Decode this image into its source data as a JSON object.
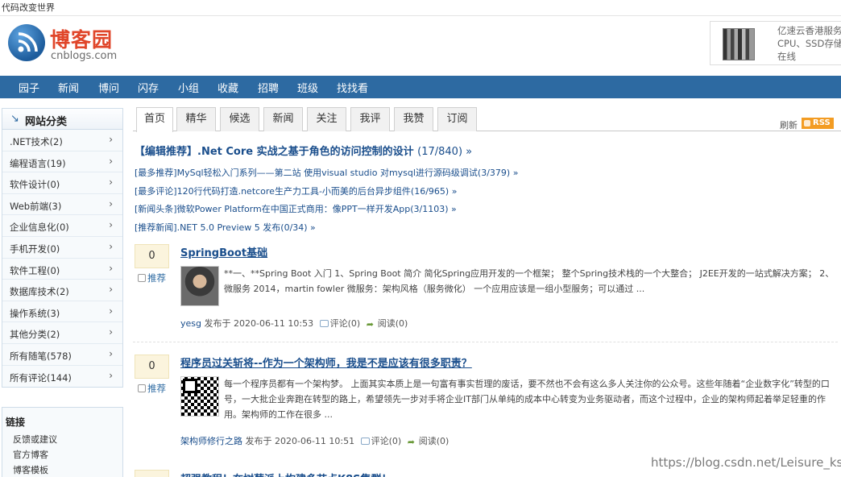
{
  "slogan": "代码改变世界",
  "logo": {
    "cn": "博客园",
    "en": "cnblogs.com"
  },
  "ad": {
    "line1": "亿速云香港服务",
    "line2": "CPU、SSD存储",
    "line3": "在线"
  },
  "nav": [
    "园子",
    "新闻",
    "博问",
    "闪存",
    "小组",
    "收藏",
    "招聘",
    "班级",
    "找找看"
  ],
  "sidebar": {
    "title": "网站分类",
    "items": [
      ".NET技术(2)",
      "编程语言(19)",
      "软件设计(0)",
      "Web前端(3)",
      "企业信息化(0)",
      "手机开发(0)",
      "软件工程(0)",
      "数据库技术(2)",
      "操作系统(3)",
      "其他分类(2)",
      "所有随笔(578)",
      "所有评论(144)"
    ]
  },
  "links": {
    "title": "链接",
    "items": [
      "反馈或建议",
      "官方博客",
      "博客模板"
    ]
  },
  "tabs": [
    "首页",
    "精华",
    "候选",
    "新闻",
    "关注",
    "我评",
    "我赞",
    "订阅"
  ],
  "refresh": "刷新",
  "rss": "RSS",
  "headline": {
    "text": "【编辑推荐】.Net Core 实战之基于角色的访问控制的设计",
    "count": "(17/840) »"
  },
  "recommendations": [
    "[最多推荐]MySql轻松入门系列——第二站 使用visual studio 对mysql进行源码级调试(3/379) »",
    "[最多评论]120行代码打造.netcore生产力工具-小而美的后台异步组件(16/965) »",
    "[新闻头条]微软Power Platform在中国正式商用：像PPT一样开发App(3/1103) »",
    "[推荐新闻].NET 5.0 Preview 5 发布(0/34) »"
  ],
  "posts": [
    {
      "votes": "0",
      "digg": "推荐",
      "title": "SpringBoot基础",
      "summary": "**一、**Spring Boot 入门 1、Spring Boot 简介 简化Spring应用开发的一个框架； 整个Spring技术栈的一个大整合； J2EE开发的一站式解决方案； 2、微服务 2014，martin fowler 微服务：架构风格（服务微化） 一个应用应该是一组小型服务；可以通过 ...",
      "author": "yesg",
      "published": "发布于 2020-06-11 10:53",
      "comments": "评论(0)",
      "reads": "阅读(0)"
    },
    {
      "votes": "0",
      "digg": "推荐",
      "title": "程序员过关斩将--作为一个架构师，我是不是应该有很多职责？",
      "summary": "每一个程序员都有一个架构梦。 上面其实本质上是一句富有事实哲理的废话，要不然也不会有这么多人关注你的公众号。这些年随着“企业数字化”转型的口号，一大批企业奔跑在转型的路上，希望领先一步对手将企业IT部门从单纯的成本中心转变为业务驱动者，而这个过程中，企业的架构师起着举足轻重的作用。架构师的工作在很多 ...",
      "author": "架构师修行之路",
      "published": "发布于 2020-06-11 10:51",
      "comments": "评论(0)",
      "reads": "阅读(0)"
    },
    {
      "title": "超强教程！在树莓派上构建多节点K8S集群！"
    }
  ],
  "watermark": "https://blog.csdn.net/Leisure_ksj"
}
